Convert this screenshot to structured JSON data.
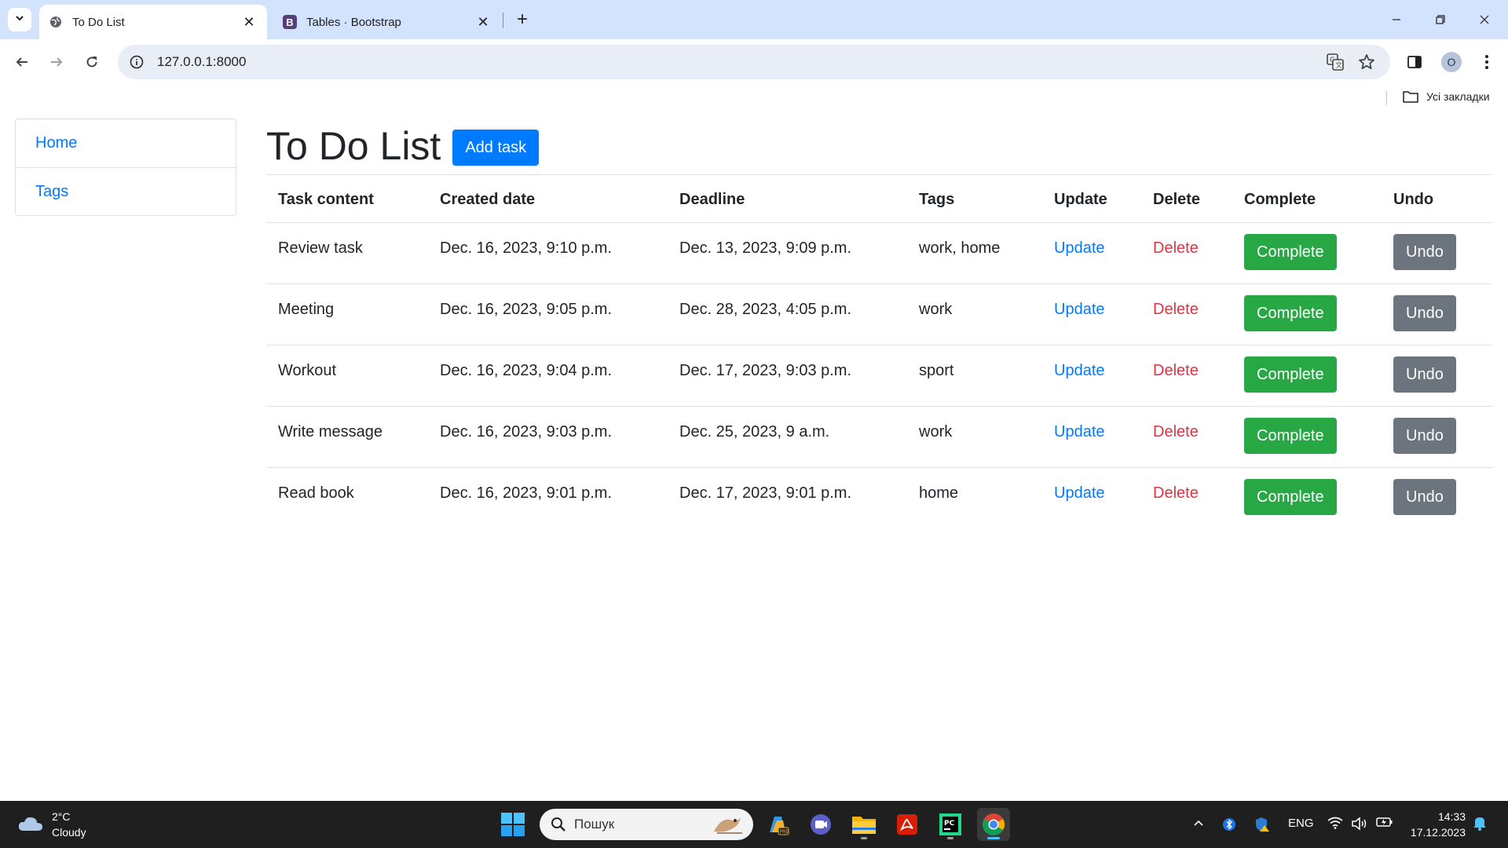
{
  "browser": {
    "tabs": [
      {
        "title": "To Do List",
        "active": true
      },
      {
        "title": "Tables · Bootstrap",
        "active": false
      }
    ],
    "url": "127.0.0.1:8000",
    "profile_initial": "O",
    "bookmarks_all_label": "Усі закладки"
  },
  "sidebar": {
    "items": [
      {
        "label": "Home"
      },
      {
        "label": "Tags"
      }
    ]
  },
  "page": {
    "title": "To Do List",
    "add_task_label": "Add task"
  },
  "table": {
    "headers": {
      "task_content": "Task content",
      "created_date": "Created date",
      "deadline": "Deadline",
      "tags": "Tags",
      "update": "Update",
      "delete": "Delete",
      "complete": "Complete",
      "undo": "Undo"
    },
    "rows": [
      {
        "content": "Review task",
        "created": "Dec. 16, 2023, 9:10 p.m.",
        "deadline": "Dec. 13, 2023, 9:09 p.m.",
        "tags": "work, home",
        "update": "Update",
        "delete": "Delete",
        "complete": "Complete",
        "undo": "Undo"
      },
      {
        "content": "Meeting",
        "created": "Dec. 16, 2023, 9:05 p.m.",
        "deadline": "Dec. 28, 2023, 4:05 p.m.",
        "tags": "work",
        "update": "Update",
        "delete": "Delete",
        "complete": "Complete",
        "undo": "Undo"
      },
      {
        "content": "Workout",
        "created": "Dec. 16, 2023, 9:04 p.m.",
        "deadline": "Dec. 17, 2023, 9:03 p.m.",
        "tags": "sport",
        "update": "Update",
        "delete": "Delete",
        "complete": "Complete",
        "undo": "Undo"
      },
      {
        "content": "Write message",
        "created": "Dec. 16, 2023, 9:03 p.m.",
        "deadline": "Dec. 25, 2023, 9 a.m.",
        "tags": "work",
        "update": "Update",
        "delete": "Delete",
        "complete": "Complete",
        "undo": "Undo"
      },
      {
        "content": "Read book",
        "created": "Dec. 16, 2023, 9:01 p.m.",
        "deadline": "Dec. 17, 2023, 9:01 p.m.",
        "tags": "home",
        "update": "Update",
        "delete": "Delete",
        "complete": "Complete",
        "undo": "Undo"
      }
    ]
  },
  "taskbar": {
    "weather": {
      "temp": "2°C",
      "condition": "Cloudy"
    },
    "search_placeholder": "Пошук",
    "language": "ENG",
    "time": "14:33",
    "date": "17.12.2023"
  },
  "colors": {
    "primary": "#007bff",
    "success": "#28a745",
    "secondary": "#6c757d",
    "danger": "#dc3545",
    "tabbar": "#d3e3fd",
    "omnibox": "#e9eef6",
    "taskbar": "#1f1f1f"
  }
}
